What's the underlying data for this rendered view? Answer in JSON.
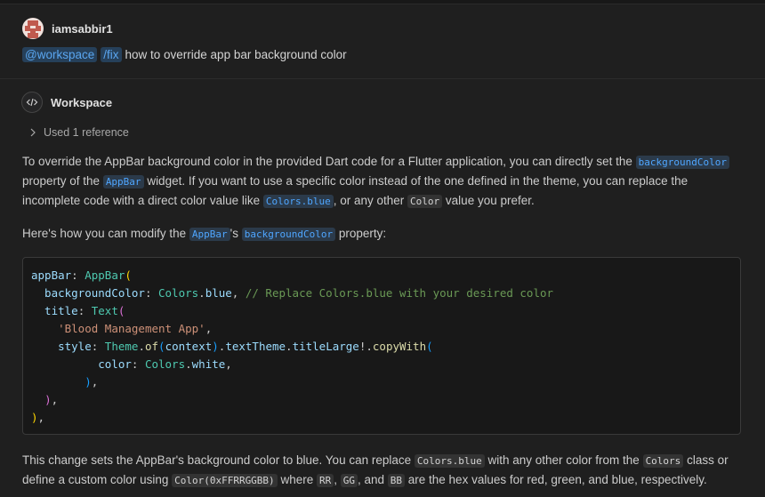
{
  "request": {
    "username": "iamsabbir1",
    "chips": [
      "@workspace",
      "/fix"
    ],
    "query": "how to override app bar background color"
  },
  "response": {
    "agent_name": "Workspace",
    "references": "Used 1 reference",
    "para1": [
      {
        "t": "To override the AppBar background color in the provided Dart code for a Flutter application, you can directly set the "
      },
      {
        "c": "backgroundColor",
        "link": true
      },
      {
        "t": " property of the "
      },
      {
        "c": "AppBar",
        "link": true
      },
      {
        "t": " widget. If you want to use a specific color instead of the one defined in the theme, you can replace the incomplete code with a direct color value like "
      },
      {
        "c": "Colors.blue",
        "link": true
      },
      {
        "t": ", or any other "
      },
      {
        "c": "Color",
        "link": false
      },
      {
        "t": " value you prefer."
      }
    ],
    "para2": [
      {
        "t": "Here's how you can modify the "
      },
      {
        "c": "AppBar",
        "link": true
      },
      {
        "t": "'s "
      },
      {
        "c": "backgroundColor",
        "link": true
      },
      {
        "t": " property:"
      }
    ],
    "code_lines": [
      [
        [
          "appBar",
          "prop"
        ],
        [
          ": ",
          "punc"
        ],
        [
          "AppBar",
          "cls"
        ],
        [
          "(",
          "p1"
        ]
      ],
      [
        [
          "  backgroundColor",
          "prop"
        ],
        [
          ": ",
          "punc"
        ],
        [
          "Colors",
          "cls"
        ],
        [
          ".",
          "punc"
        ],
        [
          "blue",
          "prop"
        ],
        [
          ", ",
          "punc"
        ],
        [
          "// Replace Colors.blue with your desired color",
          "com"
        ]
      ],
      [
        [
          "  title",
          "prop"
        ],
        [
          ": ",
          "punc"
        ],
        [
          "Text",
          "cls"
        ],
        [
          "(",
          "p2"
        ]
      ],
      [
        [
          "    ",
          "punc"
        ],
        [
          "'Blood Management App'",
          "str"
        ],
        [
          ",",
          "punc"
        ]
      ],
      [
        [
          "    style",
          "prop"
        ],
        [
          ": ",
          "punc"
        ],
        [
          "Theme",
          "cls"
        ],
        [
          ".",
          "punc"
        ],
        [
          "of",
          "fn"
        ],
        [
          "(",
          "p3"
        ],
        [
          "context",
          "prop"
        ],
        [
          ")",
          "p3"
        ],
        [
          ".",
          "punc"
        ],
        [
          "textTheme",
          "prop"
        ],
        [
          ".",
          "punc"
        ],
        [
          "titleLarge",
          "prop"
        ],
        [
          "!.",
          "punc"
        ],
        [
          "copyWith",
          "fn"
        ],
        [
          "(",
          "p3"
        ]
      ],
      [
        [
          "          color",
          "prop"
        ],
        [
          ": ",
          "punc"
        ],
        [
          "Colors",
          "cls"
        ],
        [
          ".",
          "punc"
        ],
        [
          "white",
          "prop"
        ],
        [
          ",",
          "punc"
        ]
      ],
      [
        [
          "        ",
          "punc"
        ],
        [
          ")",
          "p3"
        ],
        [
          ",",
          "punc"
        ]
      ],
      [
        [
          "  ",
          "punc"
        ],
        [
          ")",
          "p2"
        ],
        [
          ",",
          "punc"
        ]
      ],
      [
        [
          ")",
          "p1"
        ],
        [
          ",",
          "punc"
        ]
      ]
    ],
    "para3": [
      {
        "t": "This change sets the AppBar's background color to blue. You can replace "
      },
      {
        "c": "Colors.blue",
        "link": false
      },
      {
        "t": " with any other color from the "
      },
      {
        "c": "Colors",
        "link": false
      },
      {
        "t": " class or define a custom color using "
      },
      {
        "c": "Color(0xFFRRGGBB)",
        "link": false
      },
      {
        "t": " where "
      },
      {
        "c": "RR",
        "link": false
      },
      {
        "t": ", "
      },
      {
        "c": "GG",
        "link": false
      },
      {
        "t": ", and "
      },
      {
        "c": "BB",
        "link": false
      },
      {
        "t": " are the hex values for red, green, and blue, respectively."
      }
    ]
  }
}
